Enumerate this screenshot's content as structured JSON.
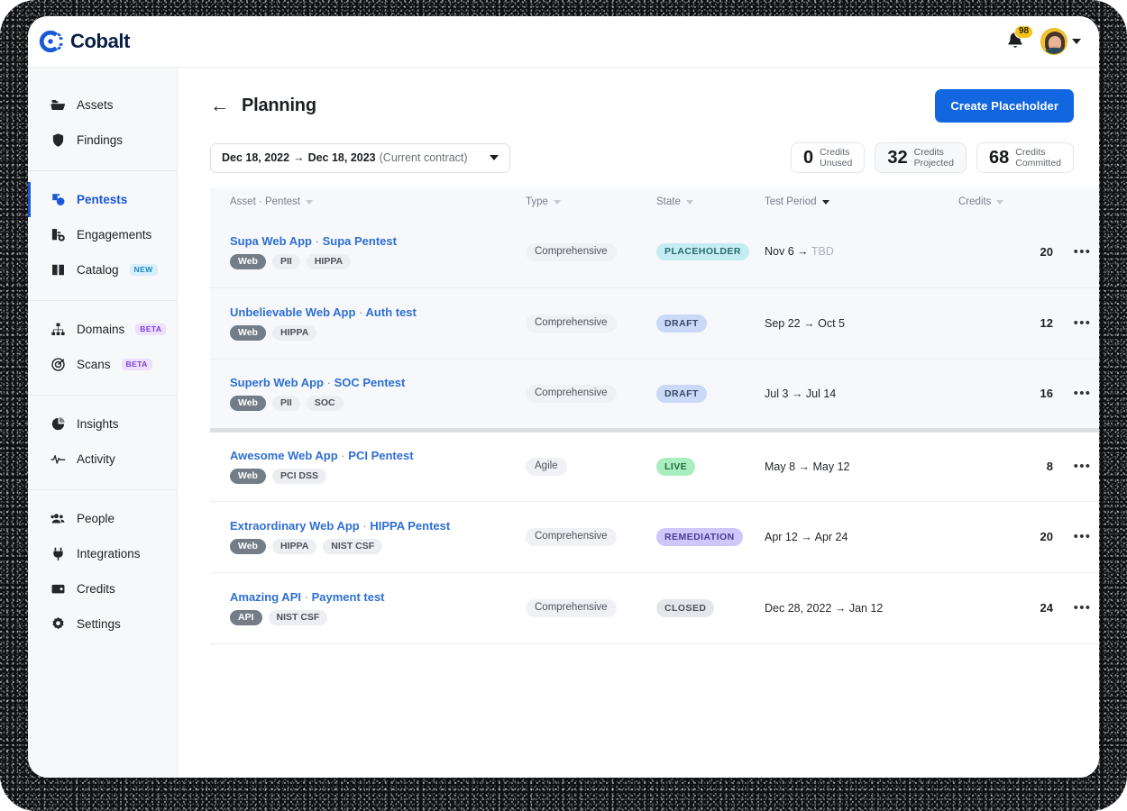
{
  "brand": {
    "name": "Cobalt",
    "logo_icon": "cobalt-gear-c-icon",
    "color": "#1759d6"
  },
  "topbar": {
    "notifications": {
      "icon": "bell-icon",
      "count": "98"
    },
    "avatar": {
      "icon": "user-avatar",
      "chevron_icon": "chevron-down-icon"
    }
  },
  "sidebar": {
    "groups": [
      {
        "items": [
          {
            "label": "Assets",
            "icon": "folder-icon",
            "active": false,
            "tag": ""
          },
          {
            "label": "Findings",
            "icon": "shield-icon",
            "active": false,
            "tag": ""
          }
        ]
      },
      {
        "items": [
          {
            "label": "Pentests",
            "icon": "pentest-icon",
            "active": true,
            "tag": ""
          },
          {
            "label": "Engagements",
            "icon": "engagements-icon",
            "active": false,
            "tag": ""
          },
          {
            "label": "Catalog",
            "icon": "book-icon",
            "active": false,
            "tag": "NEW"
          }
        ]
      },
      {
        "items": [
          {
            "label": "Domains",
            "icon": "sitemap-icon",
            "active": false,
            "tag": "BETA"
          },
          {
            "label": "Scans",
            "icon": "target-icon",
            "active": false,
            "tag": "BETA"
          }
        ]
      },
      {
        "items": [
          {
            "label": "Insights",
            "icon": "pie-chart-icon",
            "active": false,
            "tag": ""
          },
          {
            "label": "Activity",
            "icon": "pulse-icon",
            "active": false,
            "tag": ""
          }
        ]
      },
      {
        "items": [
          {
            "label": "People",
            "icon": "people-icon",
            "active": false,
            "tag": ""
          },
          {
            "label": "Integrations",
            "icon": "plug-icon",
            "active": false,
            "tag": ""
          },
          {
            "label": "Credits",
            "icon": "wallet-icon",
            "active": false,
            "tag": ""
          },
          {
            "label": "Settings",
            "icon": "gear-icon",
            "active": false,
            "tag": ""
          }
        ]
      }
    ]
  },
  "page": {
    "back_icon": "arrow-left-icon",
    "title": "Planning",
    "create_button": "Create Placeholder"
  },
  "filters": {
    "date_range": {
      "start": "Dec 18, 2022",
      "arrow": "→",
      "end": "Dec 18, 2023",
      "suffix": "(Current contract)",
      "caret_icon": "caret-down-icon"
    }
  },
  "credits_summary": [
    {
      "value": "0",
      "label_line1": "Credits",
      "label_line2": "Unused",
      "shaded": false
    },
    {
      "value": "32",
      "label_line1": "Credits",
      "label_line2": "Projected",
      "shaded": true
    },
    {
      "value": "68",
      "label_line1": "Credits",
      "label_line2": "Committed",
      "shaded": false
    }
  ],
  "table": {
    "columns": [
      {
        "label": "Asset · Pentest",
        "sorted": false
      },
      {
        "label": "Type",
        "sorted": false
      },
      {
        "label": "State",
        "sorted": false
      },
      {
        "label": "Test Period",
        "sorted": true
      },
      {
        "label": "Credits",
        "sorted": false
      },
      {
        "label": "",
        "sorted": false
      }
    ],
    "rows": [
      {
        "asset": "Supa Web App",
        "separator": "·",
        "pentest": "Supa Pentest",
        "tags": [
          {
            "text": "Web",
            "dark": true
          },
          {
            "text": "PII",
            "dark": false
          },
          {
            "text": "HIPPA",
            "dark": false
          }
        ],
        "type": "Comprehensive",
        "state": "PLACEHOLDER",
        "state_style": "placeholder",
        "period_start": "Nov 6",
        "period_arrow": "→",
        "period_end": "TBD",
        "period_end_tbd": true,
        "credits": "20",
        "menu_icon": "ellipsis-icon",
        "shaded": true,
        "thick_below": false
      },
      {
        "asset": "Unbelievable Web App",
        "separator": "·",
        "pentest": "Auth test",
        "tags": [
          {
            "text": "Web",
            "dark": true
          },
          {
            "text": "HIPPA",
            "dark": false
          }
        ],
        "type": "Comprehensive",
        "state": "DRAFT",
        "state_style": "draft",
        "period_start": "Sep 22",
        "period_arrow": "→",
        "period_end": "Oct 5",
        "period_end_tbd": false,
        "credits": "12",
        "menu_icon": "ellipsis-icon",
        "shaded": true,
        "thick_below": false
      },
      {
        "asset": "Superb Web App",
        "separator": "·",
        "pentest": "SOC Pentest",
        "tags": [
          {
            "text": "Web",
            "dark": true
          },
          {
            "text": "PII",
            "dark": false
          },
          {
            "text": "SOC",
            "dark": false
          }
        ],
        "type": "Comprehensive",
        "state": "DRAFT",
        "state_style": "draft",
        "period_start": "Jul 3",
        "period_arrow": "→",
        "period_end": "Jul 14",
        "period_end_tbd": false,
        "credits": "16",
        "menu_icon": "ellipsis-icon",
        "shaded": true,
        "thick_below": true
      },
      {
        "asset": "Awesome Web App",
        "separator": "·",
        "pentest": "PCI Pentest",
        "tags": [
          {
            "text": "Web",
            "dark": true
          },
          {
            "text": "PCI DSS",
            "dark": false
          }
        ],
        "type": "Agile",
        "state": "LIVE",
        "state_style": "live",
        "period_start": "May 8",
        "period_arrow": "→",
        "period_end": "May 12",
        "period_end_tbd": false,
        "credits": "8",
        "menu_icon": "ellipsis-icon",
        "shaded": false,
        "thick_below": false
      },
      {
        "asset": "Extraordinary Web App",
        "separator": "·",
        "pentest": "HIPPA Pentest",
        "tags": [
          {
            "text": "Web",
            "dark": true
          },
          {
            "text": "HIPPA",
            "dark": false
          },
          {
            "text": "NIST CSF",
            "dark": false
          }
        ],
        "type": "Comprehensive",
        "state": "REMEDIATION",
        "state_style": "remediation",
        "period_start": "Apr 12",
        "period_arrow": "→",
        "period_end": "Apr 24",
        "period_end_tbd": false,
        "credits": "20",
        "menu_icon": "ellipsis-icon",
        "shaded": false,
        "thick_below": false
      },
      {
        "asset": "Amazing API",
        "separator": "·",
        "pentest": "Payment test",
        "tags": [
          {
            "text": "API",
            "dark": true
          },
          {
            "text": "NIST CSF",
            "dark": false
          }
        ],
        "type": "Comprehensive",
        "state": "CLOSED",
        "state_style": "closed",
        "period_start": "Dec 28, 2022",
        "period_arrow": "→",
        "period_end": "Jan 12",
        "period_end_tbd": false,
        "credits": "24",
        "menu_icon": "ellipsis-icon",
        "shaded": false,
        "thick_below": false
      }
    ]
  }
}
